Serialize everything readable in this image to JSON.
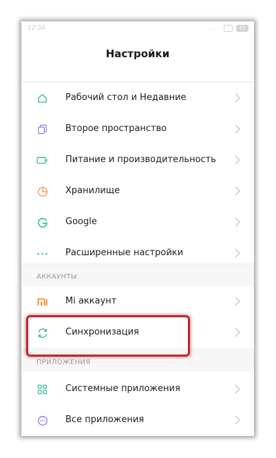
{
  "status_bar": {
    "time": "12:34",
    "signal": "....",
    "battery": "37"
  },
  "header": {
    "title": "Настройки"
  },
  "settings_rows": [
    {
      "label": "Рабочий стол и Недавние",
      "icon": "home-icon"
    },
    {
      "label": "Второе пространство",
      "icon": "copy-icon"
    },
    {
      "label": "Питание и производительность",
      "icon": "battery-icon"
    },
    {
      "label": "Хранилище",
      "icon": "pie-chart-icon"
    },
    {
      "label": "Google",
      "icon": "google-icon"
    },
    {
      "label": "Расширенные настройки",
      "icon": "more-dots-icon"
    }
  ],
  "accounts": {
    "header": "АККАУНТЫ",
    "rows": [
      {
        "label": "Mi аккаунт",
        "icon": "mi-logo-icon"
      },
      {
        "label": "Синхронизация",
        "icon": "sync-icon"
      }
    ]
  },
  "apps": {
    "header": "ПРИЛОЖЕНИЯ",
    "rows": [
      {
        "label": "Системные приложения",
        "icon": "grid-icon"
      },
      {
        "label": "Все приложения",
        "icon": "chat-dots-icon"
      }
    ]
  },
  "colors": {
    "icon_teal": "#35b89e",
    "icon_purple": "#8a7be0",
    "icon_orange": "#f29a5e",
    "mi_orange": "#f5871f",
    "highlight_red": "#c0262d",
    "chevron": "#c4c4c4"
  }
}
